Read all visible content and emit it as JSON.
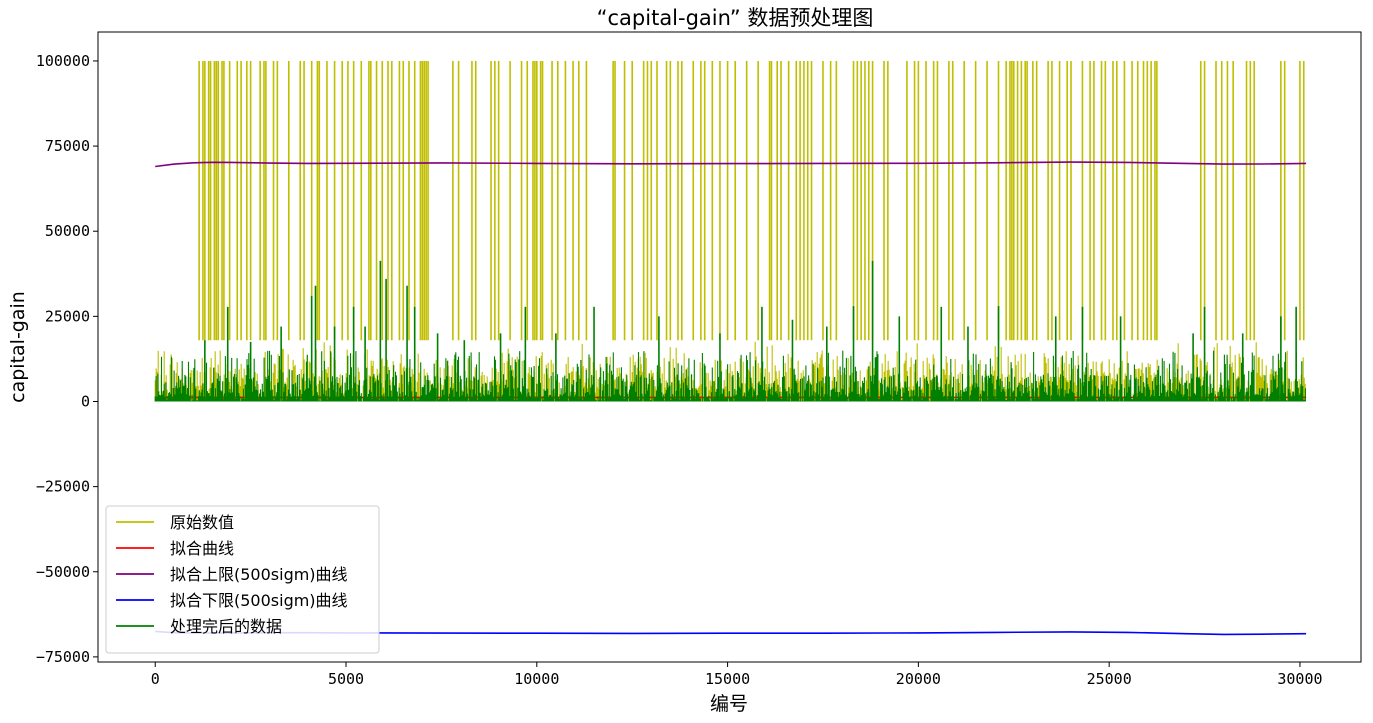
{
  "chart_data": {
    "type": "line",
    "title": "“capital-gain” 数据预处理图",
    "xlabel": "编号",
    "ylabel": "capital-gain",
    "xlim": [
      -1500,
      31600
    ],
    "ylim": [
      -76500,
      108500
    ],
    "xticks": [
      0,
      5000,
      10000,
      15000,
      20000,
      25000,
      30000
    ],
    "xtick_labels": [
      "0",
      "5000",
      "10000",
      "15000",
      "20000",
      "25000",
      "30000"
    ],
    "yticks": [
      100000,
      75000,
      50000,
      25000,
      0,
      -25000,
      -50000,
      -75000
    ],
    "ytick_labels": [
      "100000",
      "75000",
      "50000",
      "25000",
      "0",
      "−25000",
      "−50000",
      "−75000"
    ],
    "grid": false,
    "legend_position": "lower-left",
    "n_points": 30162,
    "series": [
      {
        "name": "原始数值",
        "color": "#bfbf00",
        "kind": "spikes",
        "baseline_max": 18000,
        "spike_value": 99999,
        "spike_x": [
          1150,
          1250,
          1300,
          1400,
          1450,
          1550,
          1600,
          1650,
          1750,
          1800,
          1950,
          2150,
          2250,
          2400,
          2500,
          2750,
          2850,
          2900,
          3100,
          3200,
          3500,
          3800,
          3900,
          4100,
          4250,
          4300,
          4500,
          4700,
          4900,
          5050,
          5200,
          5400,
          5600,
          5650,
          5800,
          5950,
          6100,
          6200,
          6400,
          6500,
          6650,
          6800,
          6950,
          7000,
          7050,
          7100,
          7150,
          7800,
          7950,
          8300,
          8400,
          8800,
          8900,
          9000,
          9300,
          9600,
          9750,
          9900,
          9950,
          10000,
          10100,
          10150,
          10400,
          10550,
          10750,
          10950,
          11100,
          11300,
          12000,
          12050,
          12300,
          12500,
          12800,
          12900,
          13000,
          13150,
          13400,
          13500,
          13700,
          13800,
          14100,
          14300,
          14400,
          14600,
          14800,
          15000,
          15200,
          15500,
          15800,
          16100,
          16150,
          16300,
          16400,
          16600,
          16800,
          16900,
          17000,
          17100,
          17200,
          17500,
          17700,
          17850,
          18300,
          18400,
          18500,
          18600,
          18700,
          18800,
          19100,
          19200,
          19700,
          19900,
          20000,
          20200,
          20400,
          20500,
          20800,
          20900,
          21200,
          21500,
          21800,
          22100,
          22300,
          22400,
          22450,
          22500,
          22600,
          22700,
          22800,
          22850,
          23000,
          23100,
          23400,
          23500,
          23700,
          23900,
          24000,
          24300,
          24500,
          24600,
          24800,
          24900,
          25100,
          25200,
          25400,
          25600,
          25750,
          25900,
          26000,
          26100,
          26200,
          26250,
          27400,
          27500,
          27800,
          27950,
          28100,
          28250,
          28600,
          28700,
          28800,
          29500,
          29600,
          30000,
          30100
        ]
      },
      {
        "name": "拟合曲线",
        "color": "#ff0000",
        "kind": "line",
        "x": [
          0,
          30162
        ],
        "y": [
          1200,
          1200
        ]
      },
      {
        "name": "拟合上限(500sigm)曲线",
        "color": "#800080",
        "kind": "line",
        "x": [
          0,
          500,
          1000,
          1500,
          2000,
          3000,
          4000,
          5000,
          7500,
          10000,
          12500,
          15000,
          17500,
          20000,
          22000,
          24000,
          25500,
          27000,
          28000,
          29000,
          30162
        ],
        "y": [
          69000,
          69700,
          70100,
          70250,
          70200,
          70000,
          69900,
          69950,
          70050,
          69900,
          69800,
          69850,
          69900,
          69950,
          70100,
          70300,
          70200,
          69900,
          69700,
          69750,
          69900
        ]
      },
      {
        "name": "拟合下限(500sigm)曲线",
        "color": "#0000ff",
        "kind": "line",
        "x": [
          0,
          500,
          1000,
          1500,
          2000,
          3000,
          4000,
          5000,
          7500,
          10000,
          12500,
          15000,
          17500,
          20000,
          22000,
          24000,
          25500,
          27000,
          28000,
          29000,
          30162
        ],
        "y": [
          -67500,
          -67900,
          -68000,
          -68000,
          -67950,
          -67900,
          -67900,
          -67950,
          -68000,
          -68050,
          -68100,
          -68050,
          -68050,
          -67950,
          -67800,
          -67650,
          -67800,
          -68200,
          -68400,
          -68350,
          -68200
        ]
      },
      {
        "name": "处理完后的数据",
        "color": "#008000",
        "kind": "noise",
        "typical_max": 15000,
        "spikes": [
          [
            1300,
            18000
          ],
          [
            1900,
            27800
          ],
          [
            2500,
            17500
          ],
          [
            3300,
            22000
          ],
          [
            4100,
            31000
          ],
          [
            4200,
            34000
          ],
          [
            4700,
            22000
          ],
          [
            5200,
            27800
          ],
          [
            5500,
            22000
          ],
          [
            5900,
            41300
          ],
          [
            6050,
            36000
          ],
          [
            6600,
            34000
          ],
          [
            6800,
            27800
          ],
          [
            7400,
            20000
          ],
          [
            8100,
            18000
          ],
          [
            9050,
            20000
          ],
          [
            9700,
            27800
          ],
          [
            10500,
            20000
          ],
          [
            11500,
            27800
          ],
          [
            13200,
            25000
          ],
          [
            14800,
            20000
          ],
          [
            15900,
            27800
          ],
          [
            16700,
            24000
          ],
          [
            17600,
            22000
          ],
          [
            18300,
            28000
          ],
          [
            18800,
            41300
          ],
          [
            19500,
            25000
          ],
          [
            20600,
            27800
          ],
          [
            21300,
            22000
          ],
          [
            22100,
            28000
          ],
          [
            23600,
            25000
          ],
          [
            24300,
            27800
          ],
          [
            25300,
            25000
          ],
          [
            27200,
            20000
          ],
          [
            27500,
            27800
          ],
          [
            28500,
            20000
          ],
          [
            29500,
            25000
          ],
          [
            29900,
            27800
          ]
        ]
      }
    ]
  }
}
